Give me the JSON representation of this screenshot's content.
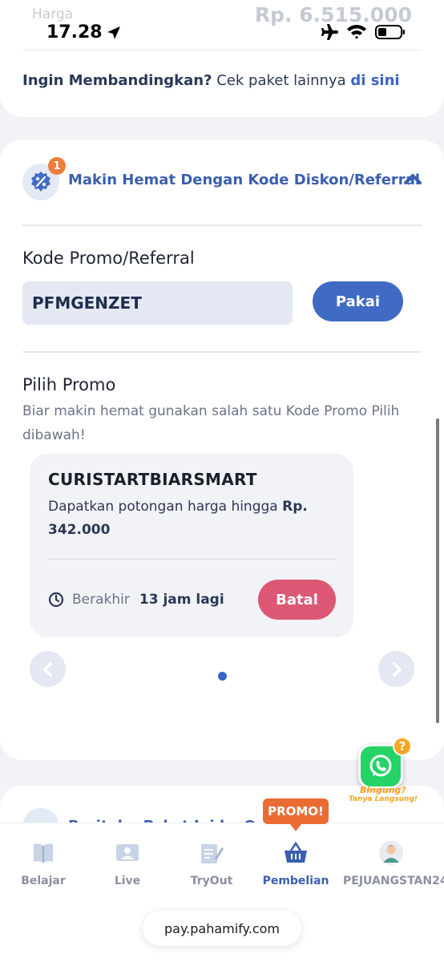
{
  "status_bar": {
    "time": "17.28",
    "ghost_label": "Harga",
    "ghost_price": "Rp. 6.515.000"
  },
  "compare": {
    "bold_text": "Ingin Membandingkan?",
    "text": "Cek paket lainnya",
    "link": "di sini"
  },
  "discount_section": {
    "badge_count": "1",
    "title": "Makin Hemat Dengan Kode Diskon/Referral",
    "promo_label": "Kode Promo/Referral",
    "promo_value": "PFMGENZET",
    "apply_button": "Pakai"
  },
  "choose_promo": {
    "title": "Pilih Promo",
    "description": "Biar makin hemat gunakan salah satu Kode Promo Pilih dibawah!",
    "card": {
      "code": "CURISTARTBIARSMART",
      "desc_prefix": "Dapatkan potongan harga hingga",
      "desc_amount": "Rp. 342.000",
      "expire_label": "Berakhir",
      "expire_value": "13 jam lagi",
      "cancel_button": "Batal"
    }
  },
  "next_section": {
    "title": "Beritahu Paket Ini ke Ortu/..."
  },
  "whatsapp": {
    "line1": "Bingung?",
    "line2": "Tanya Langsung!",
    "badge": "?"
  },
  "tabbar": {
    "promo_tag": "PROMO!",
    "tabs": [
      {
        "label": "Belajar"
      },
      {
        "label": "Live"
      },
      {
        "label": "TryOut"
      },
      {
        "label": "Pembelian"
      },
      {
        "label": "PEJUANGSTAN24"
      }
    ],
    "active_tab": "Pembelian"
  },
  "browser": {
    "url": "pay.pahamify.com"
  },
  "colors": {
    "accent": "#3b63c4",
    "danger": "#dc5874",
    "promo": "#ea6c34",
    "whatsapp": "#25d366"
  }
}
